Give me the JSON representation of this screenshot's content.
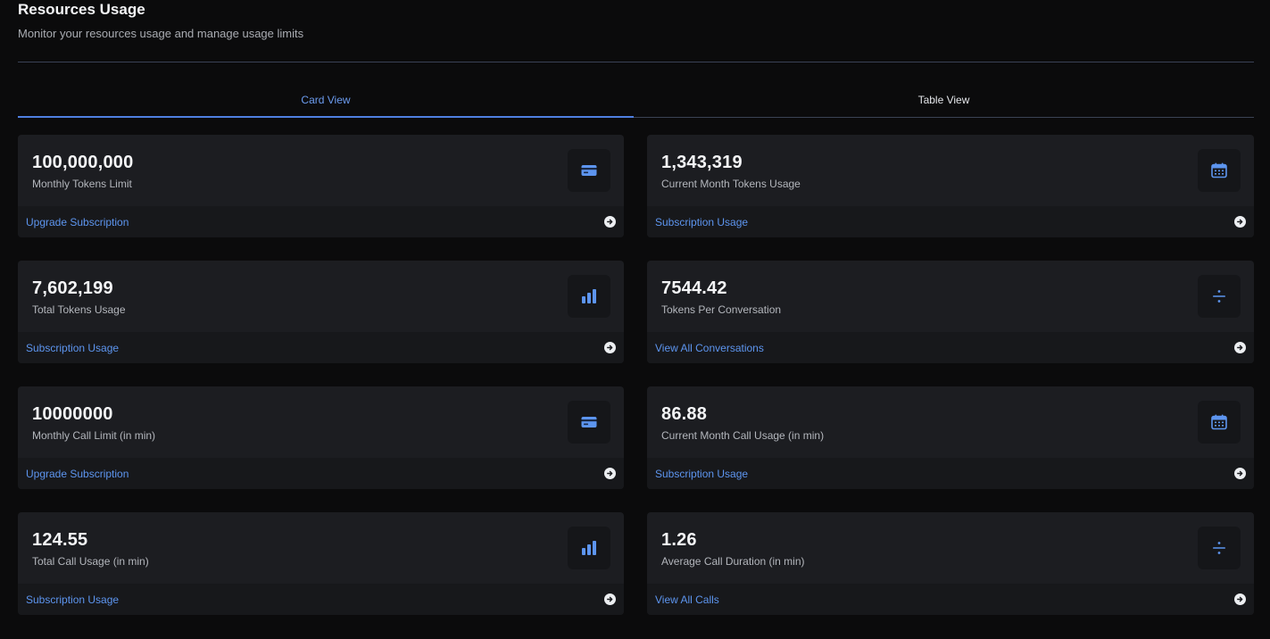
{
  "header": {
    "title": "Resources Usage",
    "subtitle": "Monitor your resources usage and manage usage limits"
  },
  "tabs": [
    {
      "label": "Card View",
      "active": true
    },
    {
      "label": "Table View",
      "active": false
    }
  ],
  "colors": {
    "accent": "#5d95ef",
    "card_bg": "#1c1d21",
    "page_bg": "#0b0b0c"
  },
  "cards": [
    {
      "value": "100,000,000",
      "label": "Monthly Tokens Limit",
      "icon": "credit-card-icon",
      "link": "Upgrade Subscription"
    },
    {
      "value": "1,343,319",
      "label": "Current Month Tokens Usage",
      "icon": "calendar-icon",
      "link": "Subscription Usage"
    },
    {
      "value": "7,602,199",
      "label": "Total Tokens Usage",
      "icon": "bar-chart-icon",
      "link": "Subscription Usage"
    },
    {
      "value": "7544.42",
      "label": "Tokens Per Conversation",
      "icon": "divide-icon",
      "link": "View All Conversations"
    },
    {
      "value": "10000000",
      "label": "Monthly Call Limit (in min)",
      "icon": "credit-card-icon",
      "link": "Upgrade Subscription"
    },
    {
      "value": "86.88",
      "label": "Current Month Call Usage (in min)",
      "icon": "calendar-icon",
      "link": "Subscription Usage"
    },
    {
      "value": "124.55",
      "label": "Total Call Usage (in min)",
      "icon": "bar-chart-icon",
      "link": "Subscription Usage"
    },
    {
      "value": "1.26",
      "label": "Average Call Duration (in min)",
      "icon": "divide-icon",
      "link": "View All Calls"
    }
  ]
}
